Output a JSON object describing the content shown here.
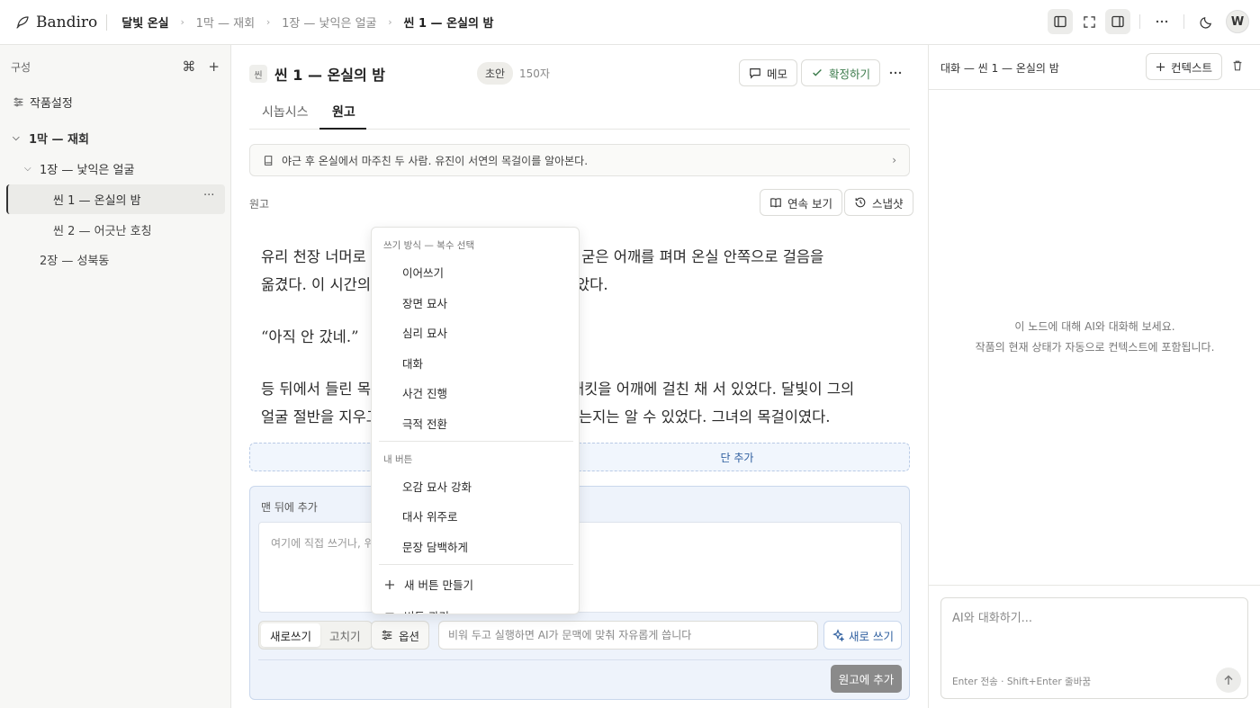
{
  "app": {
    "brand": "Bandiro",
    "breadcrumb": [
      "달빛 온실",
      "1막 — 재회",
      "1장 — 낯익은 얼굴",
      "씬 1 — 온실의 밤"
    ],
    "avatar": "W"
  },
  "sidebar": {
    "label": "구성",
    "cmd_symbol": "⌘",
    "add_symbol": "+",
    "items": [
      {
        "label": "작품설정"
      },
      {
        "label": "1막 — 재회"
      },
      {
        "label": "1장 — 낯익은 얼굴"
      },
      {
        "label": "씬 1 — 온실의 밤"
      },
      {
        "label": "씬 2 — 어긋난 호칭"
      },
      {
        "label": "2장 — 성북동"
      }
    ],
    "more": "···"
  },
  "scene": {
    "tag": "씬",
    "title": "씬 1 — 온실의 밤",
    "status_badge": "초안",
    "char_count": "150자",
    "memo_label": "메모",
    "confirm_label": "확정하기",
    "more": "···",
    "tabs": [
      "시놉시스",
      "원고"
    ],
    "synopsis": "야근 후 온실에서 마주친 두 사람. 유진이 서연의 목걸이를 알아본다.",
    "section_label": "원고",
    "continuous_view": "연속 보기",
    "snapshot": "스냅샷",
    "paragraphs": [
      "유리 천장 너머로 ········ 로 굳은 어깨를 펴며 온실 안쪽으로 걸음을 옮겼다. 이 시간의 ········ 았다.",
      "“아직 안 갔네.”",
      "등 뒤에서 들린 목 ········ 재킷을 어깨에 걸친 채 서 있었다. 달빛이 그의 얼굴 절반을 지우고 ········ 는지는 알 수 있었다. 그녀의 목걸이였다."
    ],
    "p1_line1_a": "유리 천장 너머로",
    "p1_line1_b": "로 굳은 어깨를 펴며 온실 안쪽으로 걸음을",
    "p1_line2_a": "옮겼다. 이 시간의",
    "p1_line2_b": "았다.",
    "p2": "“아직 안 갔네.”",
    "p3_line1_a": "등 뒤에서 들린 목",
    "p3_line1_b": "재킷을 어깨에 걸친 채 서 있었다. 달빛이 그의",
    "p3_line2_a": "얼굴 절반을 지우고",
    "p3_line2_b": "는지는 알 수 있었다. 그녀의 목걸이였다.",
    "add_paragraph": "단 추가"
  },
  "compose": {
    "header": "맨 뒤에 추가",
    "placeholder": "여기에 직접 쓰거나, 위",
    "mode_new": "새로쓰기",
    "mode_edit": "고치기",
    "options_label": "옵션",
    "instruction_placeholder": "비워 두고 실행하면 AI가 문맥에 맞춰 자유롭게 씁니다",
    "generate_label": "새로 쓰기",
    "submit_label": "원고에 추가"
  },
  "menu": {
    "group1": "쓰기 방식 — 복수 선택",
    "styles": [
      "이어쓰기",
      "장면 묘사",
      "심리 묘사",
      "대화",
      "사건 진행",
      "극적 전환"
    ],
    "group2": "내 버튼",
    "custom": [
      "오감 묘사 강화",
      "대사 위주로",
      "문장 담백하게"
    ],
    "new_button": "새 버튼 만들기",
    "manage_buttons": "버튼 관리"
  },
  "chat": {
    "title": "대화 — 씬 1 — 온실의 밤",
    "context_label": "컨텍스트",
    "empty_line1": "이 노드에 대해 AI와 대화해 보세요.",
    "empty_line2": "작품의 현재 상태가 자동으로 컨텍스트에 포함됩니다.",
    "input_placeholder": "AI와 대화하기...",
    "hint": "Enter 전송 · Shift+Enter 줄바꿈"
  }
}
